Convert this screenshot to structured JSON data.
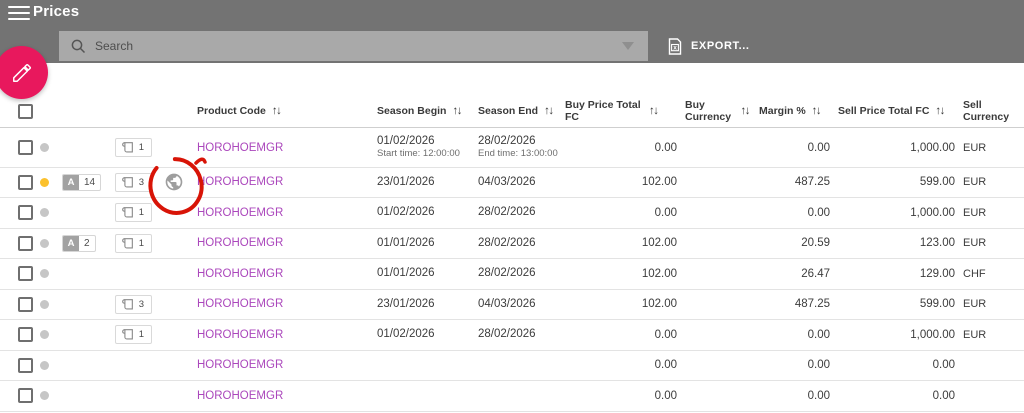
{
  "colors": {
    "header_gray": "#737373",
    "accent_pink": "#e8185d",
    "link_purple": "#ab47bc",
    "annotation_red": "#d81407",
    "status_yellow": "#fbc12d",
    "status_gray": "#c6c6c6"
  },
  "app": {
    "title": "Prices"
  },
  "toolbar": {
    "search_placeholder": "Search",
    "export_label": "EXPORT..."
  },
  "table": {
    "sort_arrows": "↑↓",
    "sort_up": "↑",
    "headers": {
      "product_code": "Product Code",
      "season_begin": "Season Begin",
      "season_end": "Season End",
      "buy_price": "Buy Price Total FC",
      "buy_currency": "Buy Currency",
      "margin": "Margin %",
      "sell_price": "Sell Price Total FC",
      "sell_currency": "Sell Currency"
    },
    "rows": [
      {
        "dot": "gray",
        "a_badge": null,
        "scroll_badge": "1",
        "globe": false,
        "code": "HOROHOEMGR",
        "season_begin": "01/02/2026",
        "season_begin_sub": "Start time: 12:00:00",
        "season_end": "28/02/2026",
        "season_end_sub": "End time: 13:00:00",
        "buy_price": "0.00",
        "buy_currency": "",
        "margin": "0.00",
        "sell_price": "1,000.00",
        "sell_currency": "EUR"
      },
      {
        "dot": "yellow",
        "a_badge": "14",
        "scroll_badge": "3",
        "globe": true,
        "code": "HOROHOEMGR",
        "season_begin": "23/01/2026",
        "season_end": "04/03/2026",
        "buy_price": "102.00",
        "buy_currency": "",
        "margin": "487.25",
        "sell_price": "599.00",
        "sell_currency": "EUR"
      },
      {
        "dot": "gray",
        "a_badge": null,
        "scroll_badge": "1",
        "globe": false,
        "code": "HOROHOEMGR",
        "season_begin": "01/02/2026",
        "season_end": "28/02/2026",
        "buy_price": "0.00",
        "buy_currency": "",
        "margin": "0.00",
        "sell_price": "1,000.00",
        "sell_currency": "EUR"
      },
      {
        "dot": "gray",
        "a_badge": "2",
        "scroll_badge": "1",
        "globe": false,
        "code": "HOROHOEMGR",
        "season_begin": "01/01/2026",
        "season_end": "28/02/2026",
        "buy_price": "102.00",
        "buy_currency": "",
        "margin": "20.59",
        "sell_price": "123.00",
        "sell_currency": "EUR"
      },
      {
        "dot": "gray",
        "a_badge": null,
        "scroll_badge": null,
        "globe": false,
        "code": "HOROHOEMGR",
        "season_begin": "01/01/2026",
        "season_end": "28/02/2026",
        "buy_price": "102.00",
        "buy_currency": "",
        "margin": "26.47",
        "sell_price": "129.00",
        "sell_currency": "CHF"
      },
      {
        "dot": "gray",
        "a_badge": null,
        "scroll_badge": "3",
        "globe": false,
        "code": "HOROHOEMGR",
        "season_begin": "23/01/2026",
        "season_end": "04/03/2026",
        "buy_price": "102.00",
        "buy_currency": "",
        "margin": "487.25",
        "sell_price": "599.00",
        "sell_currency": "EUR"
      },
      {
        "dot": "gray",
        "a_badge": null,
        "scroll_badge": "1",
        "globe": false,
        "code": "HOROHOEMGR",
        "season_begin": "01/02/2026",
        "season_end": "28/02/2026",
        "buy_price": "0.00",
        "buy_currency": "",
        "margin": "0.00",
        "sell_price": "1,000.00",
        "sell_currency": "EUR"
      },
      {
        "dot": "gray",
        "a_badge": null,
        "scroll_badge": null,
        "globe": false,
        "code": "HOROHOEMGR",
        "season_begin": "",
        "season_end": "",
        "buy_price": "0.00",
        "buy_currency": "",
        "margin": "0.00",
        "sell_price": "0.00",
        "sell_currency": ""
      },
      {
        "dot": "gray",
        "a_badge": null,
        "scroll_badge": null,
        "globe": false,
        "code": "HOROHOEMGR",
        "season_begin": "",
        "season_end": "",
        "buy_price": "0.00",
        "buy_currency": "",
        "margin": "0.00",
        "sell_price": "0.00",
        "sell_currency": ""
      }
    ]
  },
  "annotation": {
    "type": "hand-drawn-circle",
    "target": "globe-icon-row-2"
  }
}
